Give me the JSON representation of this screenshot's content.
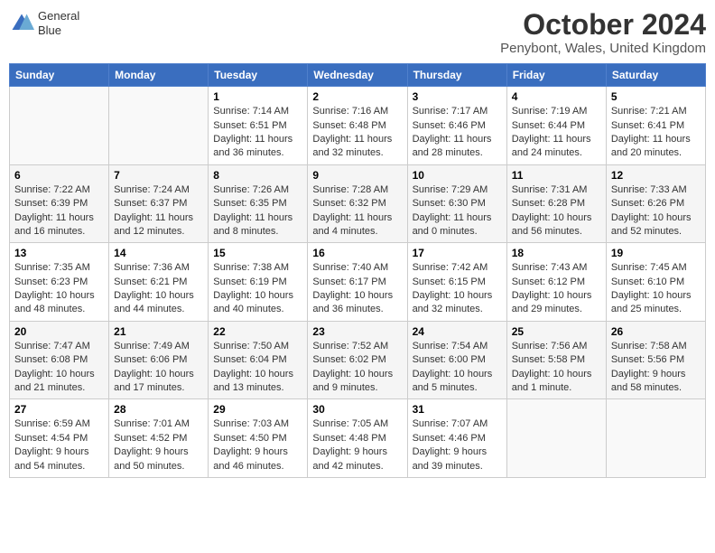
{
  "header": {
    "logo_line1": "General",
    "logo_line2": "Blue",
    "month_title": "October 2024",
    "location": "Penybont, Wales, United Kingdom"
  },
  "weekdays": [
    "Sunday",
    "Monday",
    "Tuesday",
    "Wednesday",
    "Thursday",
    "Friday",
    "Saturday"
  ],
  "weeks": [
    [
      {
        "day": "",
        "info": ""
      },
      {
        "day": "",
        "info": ""
      },
      {
        "day": "1",
        "info": "Sunrise: 7:14 AM\nSunset: 6:51 PM\nDaylight: 11 hours and 36 minutes."
      },
      {
        "day": "2",
        "info": "Sunrise: 7:16 AM\nSunset: 6:48 PM\nDaylight: 11 hours and 32 minutes."
      },
      {
        "day": "3",
        "info": "Sunrise: 7:17 AM\nSunset: 6:46 PM\nDaylight: 11 hours and 28 minutes."
      },
      {
        "day": "4",
        "info": "Sunrise: 7:19 AM\nSunset: 6:44 PM\nDaylight: 11 hours and 24 minutes."
      },
      {
        "day": "5",
        "info": "Sunrise: 7:21 AM\nSunset: 6:41 PM\nDaylight: 11 hours and 20 minutes."
      }
    ],
    [
      {
        "day": "6",
        "info": "Sunrise: 7:22 AM\nSunset: 6:39 PM\nDaylight: 11 hours and 16 minutes."
      },
      {
        "day": "7",
        "info": "Sunrise: 7:24 AM\nSunset: 6:37 PM\nDaylight: 11 hours and 12 minutes."
      },
      {
        "day": "8",
        "info": "Sunrise: 7:26 AM\nSunset: 6:35 PM\nDaylight: 11 hours and 8 minutes."
      },
      {
        "day": "9",
        "info": "Sunrise: 7:28 AM\nSunset: 6:32 PM\nDaylight: 11 hours and 4 minutes."
      },
      {
        "day": "10",
        "info": "Sunrise: 7:29 AM\nSunset: 6:30 PM\nDaylight: 11 hours and 0 minutes."
      },
      {
        "day": "11",
        "info": "Sunrise: 7:31 AM\nSunset: 6:28 PM\nDaylight: 10 hours and 56 minutes."
      },
      {
        "day": "12",
        "info": "Sunrise: 7:33 AM\nSunset: 6:26 PM\nDaylight: 10 hours and 52 minutes."
      }
    ],
    [
      {
        "day": "13",
        "info": "Sunrise: 7:35 AM\nSunset: 6:23 PM\nDaylight: 10 hours and 48 minutes."
      },
      {
        "day": "14",
        "info": "Sunrise: 7:36 AM\nSunset: 6:21 PM\nDaylight: 10 hours and 44 minutes."
      },
      {
        "day": "15",
        "info": "Sunrise: 7:38 AM\nSunset: 6:19 PM\nDaylight: 10 hours and 40 minutes."
      },
      {
        "day": "16",
        "info": "Sunrise: 7:40 AM\nSunset: 6:17 PM\nDaylight: 10 hours and 36 minutes."
      },
      {
        "day": "17",
        "info": "Sunrise: 7:42 AM\nSunset: 6:15 PM\nDaylight: 10 hours and 32 minutes."
      },
      {
        "day": "18",
        "info": "Sunrise: 7:43 AM\nSunset: 6:12 PM\nDaylight: 10 hours and 29 minutes."
      },
      {
        "day": "19",
        "info": "Sunrise: 7:45 AM\nSunset: 6:10 PM\nDaylight: 10 hours and 25 minutes."
      }
    ],
    [
      {
        "day": "20",
        "info": "Sunrise: 7:47 AM\nSunset: 6:08 PM\nDaylight: 10 hours and 21 minutes."
      },
      {
        "day": "21",
        "info": "Sunrise: 7:49 AM\nSunset: 6:06 PM\nDaylight: 10 hours and 17 minutes."
      },
      {
        "day": "22",
        "info": "Sunrise: 7:50 AM\nSunset: 6:04 PM\nDaylight: 10 hours and 13 minutes."
      },
      {
        "day": "23",
        "info": "Sunrise: 7:52 AM\nSunset: 6:02 PM\nDaylight: 10 hours and 9 minutes."
      },
      {
        "day": "24",
        "info": "Sunrise: 7:54 AM\nSunset: 6:00 PM\nDaylight: 10 hours and 5 minutes."
      },
      {
        "day": "25",
        "info": "Sunrise: 7:56 AM\nSunset: 5:58 PM\nDaylight: 10 hours and 1 minute."
      },
      {
        "day": "26",
        "info": "Sunrise: 7:58 AM\nSunset: 5:56 PM\nDaylight: 9 hours and 58 minutes."
      }
    ],
    [
      {
        "day": "27",
        "info": "Sunrise: 6:59 AM\nSunset: 4:54 PM\nDaylight: 9 hours and 54 minutes."
      },
      {
        "day": "28",
        "info": "Sunrise: 7:01 AM\nSunset: 4:52 PM\nDaylight: 9 hours and 50 minutes."
      },
      {
        "day": "29",
        "info": "Sunrise: 7:03 AM\nSunset: 4:50 PM\nDaylight: 9 hours and 46 minutes."
      },
      {
        "day": "30",
        "info": "Sunrise: 7:05 AM\nSunset: 4:48 PM\nDaylight: 9 hours and 42 minutes."
      },
      {
        "day": "31",
        "info": "Sunrise: 7:07 AM\nSunset: 4:46 PM\nDaylight: 9 hours and 39 minutes."
      },
      {
        "day": "",
        "info": ""
      },
      {
        "day": "",
        "info": ""
      }
    ]
  ]
}
